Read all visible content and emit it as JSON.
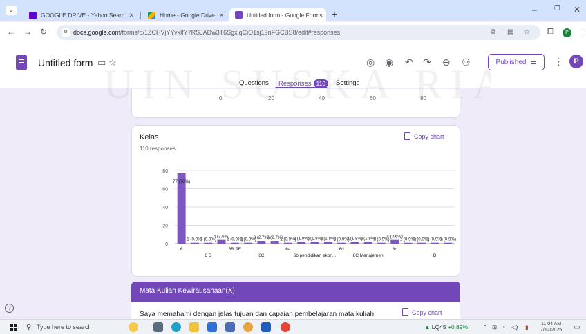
{
  "browser": {
    "tabs": [
      {
        "label": "GOOGLE DRIVE - Yahoo Search",
        "icon": "yahoo-icon",
        "color": "#6001d2"
      },
      {
        "label": "Home - Google Drive",
        "icon": "google-drive-icon",
        "color": "#f4b400"
      },
      {
        "label": "Untitled form - Google Forms",
        "icon": "google-forms-icon",
        "color": "#7248b9"
      }
    ],
    "url_domain": "docs.google.com",
    "url_rest": "/forms/d/1ZCHVjYYvklfY7RSJADw3T6SgxlqCiO1sj19nFGCBS8/edit#responses"
  },
  "form": {
    "title": "Untitled form",
    "published_label": "Published",
    "avatar_letter": "P",
    "tabs": {
      "questions": "Questions",
      "responses": "Responses",
      "responses_count": "110",
      "settings": "Settings"
    }
  },
  "prev_axis_ticks": [
    "0",
    "20",
    "40",
    "60",
    "80"
  ],
  "kelas": {
    "title": "Kelas",
    "responses": "110 responses",
    "copy_label": "Copy chart"
  },
  "chart_data": {
    "type": "bar",
    "title": "Kelas",
    "ylim": [
      0,
      80
    ],
    "yticks": [
      0,
      20,
      40,
      60,
      80
    ],
    "grid": true,
    "color": "#7e57c2",
    "values": [
      77,
      1,
      1,
      4,
      1,
      1,
      3,
      3,
      1,
      2,
      2,
      2,
      1,
      2,
      2,
      1,
      4,
      1,
      1,
      1,
      1
    ],
    "bar_labels": [
      "77 (70%)",
      "1 (0.9%)",
      "1 (0.9%)",
      "4 (3.6%)",
      "1 (0.9%)",
      "1 (0.9%)",
      "3 (2.7%)",
      "3 (2.7%)",
      "1 (0.9%)",
      "2 (1.8%)",
      "2 (1.8%)",
      "2 (1.8%)",
      "1 (0.9%)",
      "2 (1.8%)",
      "2 (1.8%)",
      "1 (0.9%)",
      "4 (3.6%)",
      "1 (0.9%)",
      "1 (0.9%)",
      "1 (0.9%)",
      "1 (0.9%)"
    ],
    "category_labels": [
      {
        "index": 0,
        "text": "6",
        "row": 0
      },
      {
        "index": 2,
        "text": "6 B",
        "row": 1
      },
      {
        "index": 4,
        "text": "6B PE",
        "row": 0
      },
      {
        "index": 6,
        "text": "6C",
        "row": 1
      },
      {
        "index": 8,
        "text": "6a",
        "row": 0
      },
      {
        "index": 10,
        "text": "6b pendidikan ekon...",
        "row": 1
      },
      {
        "index": 12,
        "text": "6d",
        "row": 0
      },
      {
        "index": 14,
        "text": "8C Manajemen",
        "row": 1
      },
      {
        "index": 16,
        "text": "8c",
        "row": 0
      },
      {
        "index": 19,
        "text": "B",
        "row": 1
      }
    ]
  },
  "next_section": {
    "title": "Mata Kuliah Kewirausahaan(X)",
    "question": "Saya memahami dengan jelas tujuan dan capaian pembelajaran mata kuliah",
    "copy_label": "Copy chart"
  },
  "taskbar": {
    "search_placeholder": "Type here to search",
    "stock_name": "LQ45",
    "stock_change": "+0.89%",
    "time": "11:04 AM",
    "date": "7/12/2025"
  },
  "watermark": "UIN SUSKA RIAU"
}
